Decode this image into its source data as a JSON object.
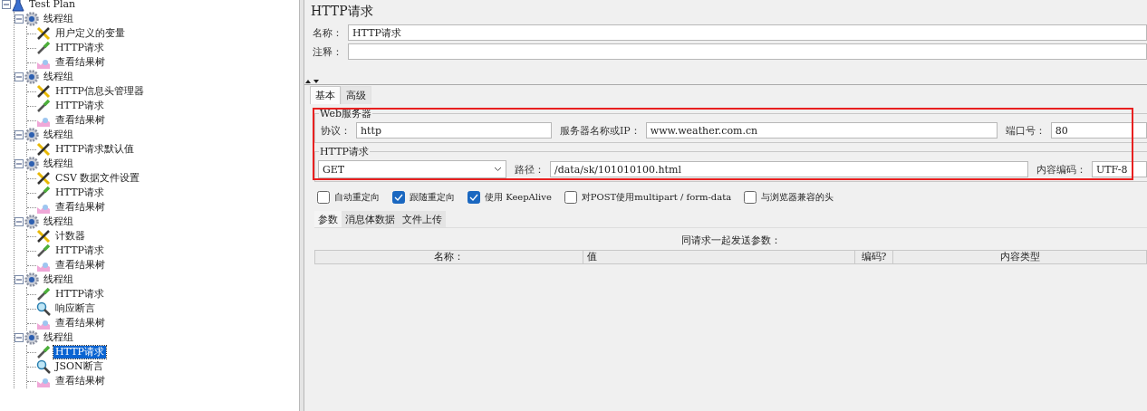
{
  "tree": {
    "kind": "plan",
    "label": "Test Plan",
    "expanded": true,
    "selected": false,
    "children": [
      {
        "kind": "thread-group",
        "label": "线程组",
        "expanded": true,
        "selected": false,
        "children": [
          {
            "kind": "config",
            "label": "用户定义的变量",
            "selected": false
          },
          {
            "kind": "sampler",
            "label": "HTTP请求",
            "selected": false
          },
          {
            "kind": "listener",
            "label": "查看结果树",
            "selected": false
          }
        ]
      },
      {
        "kind": "thread-group",
        "label": "线程组",
        "expanded": true,
        "selected": false,
        "children": [
          {
            "kind": "config",
            "label": "HTTP信息头管理器",
            "selected": false
          },
          {
            "kind": "sampler",
            "label": "HTTP请求",
            "selected": false
          },
          {
            "kind": "listener",
            "label": "查看结果树",
            "selected": false
          }
        ]
      },
      {
        "kind": "thread-group",
        "label": "线程组",
        "expanded": true,
        "selected": false,
        "children": [
          {
            "kind": "config",
            "label": "HTTP请求默认值",
            "selected": false
          }
        ]
      },
      {
        "kind": "thread-group",
        "label": "线程组",
        "expanded": true,
        "selected": false,
        "children": [
          {
            "kind": "config",
            "label": "CSV 数据文件设置",
            "selected": false
          },
          {
            "kind": "sampler",
            "label": "HTTP请求",
            "selected": false
          },
          {
            "kind": "listener",
            "label": "查看结果树",
            "selected": false
          }
        ]
      },
      {
        "kind": "thread-group",
        "label": "线程组",
        "expanded": true,
        "selected": false,
        "children": [
          {
            "kind": "config",
            "label": "计数器",
            "selected": false
          },
          {
            "kind": "sampler",
            "label": "HTTP请求",
            "selected": false
          },
          {
            "kind": "listener",
            "label": "查看结果树",
            "selected": false
          }
        ]
      },
      {
        "kind": "thread-group",
        "label": "线程组",
        "expanded": true,
        "selected": false,
        "children": [
          {
            "kind": "sampler",
            "label": "HTTP请求",
            "selected": false
          },
          {
            "kind": "assertion",
            "label": "响应断言",
            "selected": false
          },
          {
            "kind": "listener",
            "label": "查看结果树",
            "selected": false
          }
        ]
      },
      {
        "kind": "thread-group",
        "label": "线程组",
        "expanded": true,
        "selected": false,
        "children": [
          {
            "kind": "sampler",
            "label": "HTTP请求",
            "selected": true
          },
          {
            "kind": "assertion",
            "label": "JSON断言",
            "selected": false
          },
          {
            "kind": "listener",
            "label": "查看结果树",
            "selected": false
          }
        ]
      }
    ]
  },
  "editor": {
    "title": "HTTP请求",
    "name_label": "名称：",
    "name_value": "HTTP请求",
    "comment_label": "注释：",
    "tabs": [
      {
        "label": "基本",
        "selected": true
      },
      {
        "label": "高级",
        "selected": false
      }
    ],
    "web_server": {
      "legend": "Web服务器",
      "protocol_label": "协议：",
      "protocol": "http",
      "server_label": "服务器名称或IP：",
      "server": "www.weather.com.cn",
      "port_label": "端口号：",
      "port": "80"
    },
    "http_request": {
      "legend": "HTTP请求",
      "method": "GET",
      "path_label": "路径：",
      "path": "/data/sk/101010100.html",
      "encoding_label": "内容编码：",
      "encoding": "UTF-8"
    },
    "options": [
      {
        "label": "自动重定向",
        "checked": false
      },
      {
        "label": "跟随重定向",
        "checked": true
      },
      {
        "label": "使用 KeepAlive",
        "checked": true
      },
      {
        "label": "对POST使用multipart / form-data",
        "checked": false
      },
      {
        "label": "与浏览器兼容的头",
        "checked": false
      }
    ],
    "sub_tabs": [
      {
        "label": "参数",
        "selected": true
      },
      {
        "label": "消息体数据",
        "selected": false
      },
      {
        "label": "文件上传",
        "selected": false
      }
    ],
    "params": {
      "caption": "同请求一起发送参数：",
      "columns": [
        "名称：",
        "值",
        "编码?",
        "内容类型"
      ]
    }
  }
}
